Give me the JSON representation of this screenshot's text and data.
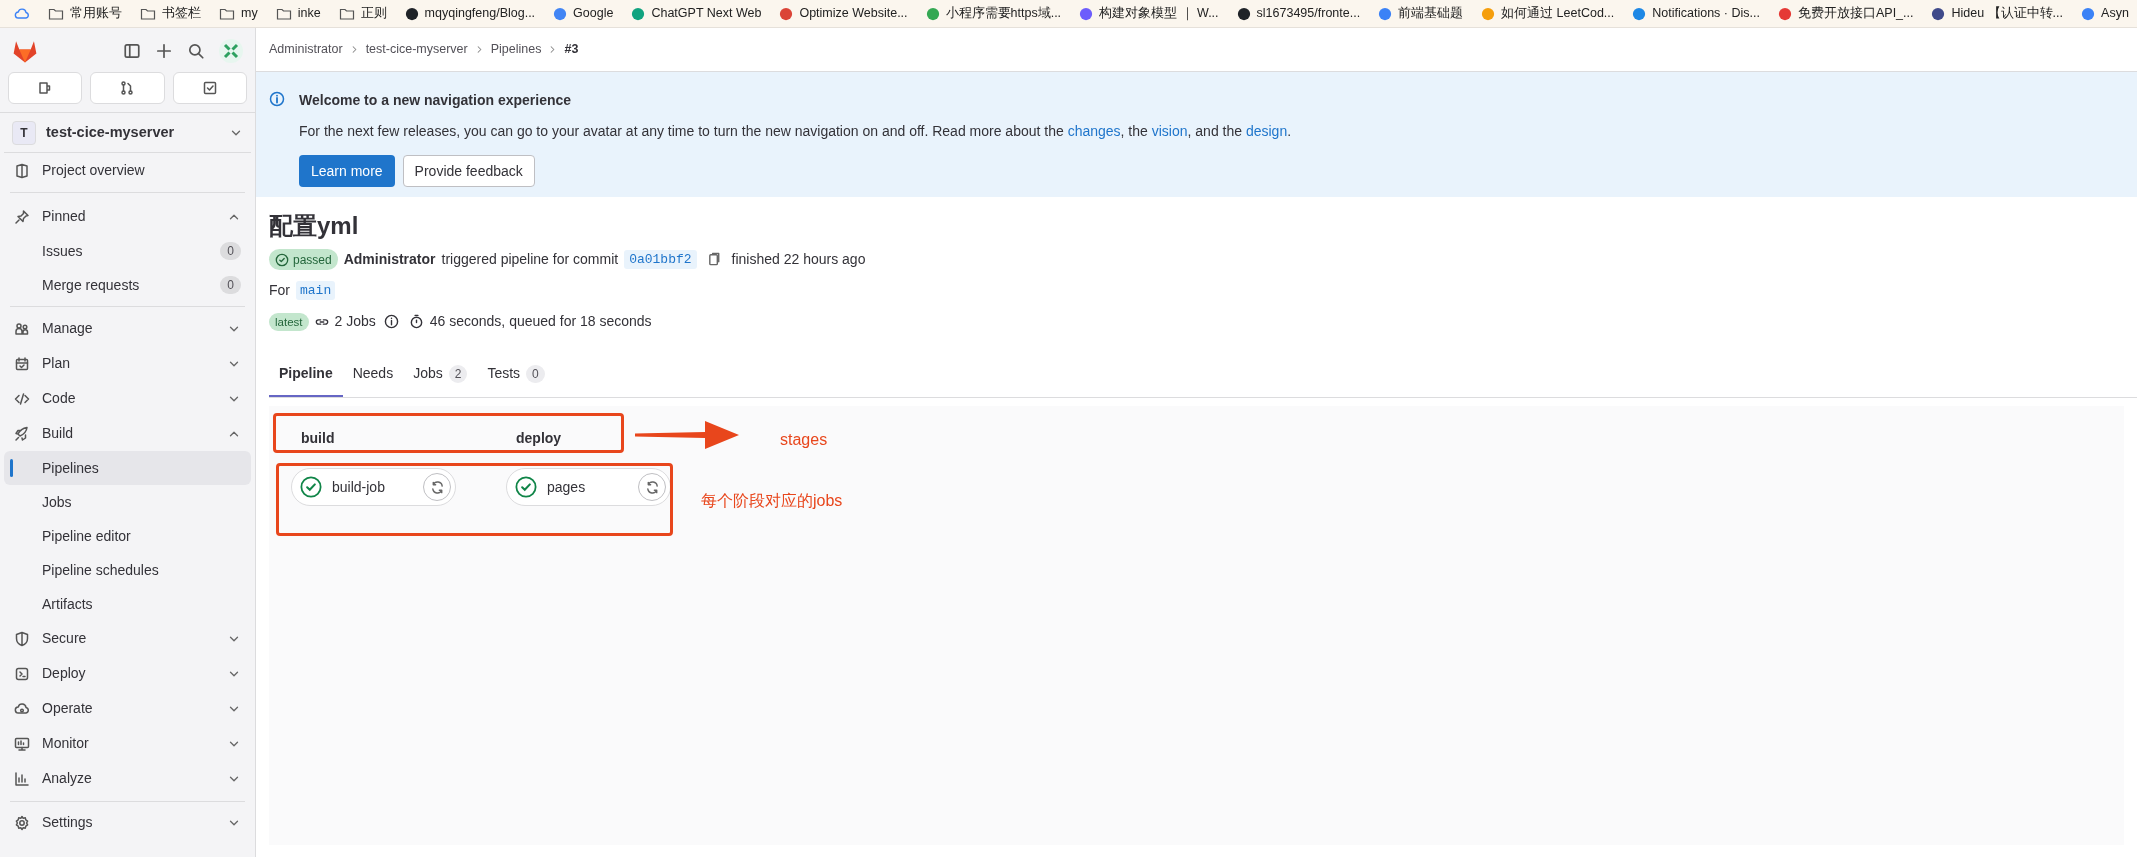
{
  "bookmarks": [
    {
      "kind": "cloud"
    },
    {
      "kind": "folder",
      "label": "常用账号"
    },
    {
      "kind": "folder",
      "label": "书签栏"
    },
    {
      "kind": "folder",
      "label": "my"
    },
    {
      "kind": "folder",
      "label": "inke"
    },
    {
      "kind": "folder",
      "label": "正则"
    },
    {
      "kind": "site",
      "label": "mqyqingfeng/Blog...",
      "color": "#1f2328"
    },
    {
      "kind": "site",
      "label": "Google",
      "color": "#4285f4"
    },
    {
      "kind": "site",
      "label": "ChatGPT Next Web",
      "color": "#10a37f"
    },
    {
      "kind": "site",
      "label": "Optimize Website...",
      "color": "#db4437"
    },
    {
      "kind": "site",
      "label": "小程序需要https域...",
      "color": "#34a853"
    },
    {
      "kind": "site",
      "label": "构建对象模型 ｜ W...",
      "color": "#6d5dfc"
    },
    {
      "kind": "site",
      "label": "sl1673495/fronte...",
      "color": "#1f2328"
    },
    {
      "kind": "site",
      "label": "前端基础题",
      "color": "#3b82f6"
    },
    {
      "kind": "site",
      "label": "如何通过 LeetCod...",
      "color": "#f59e0b"
    },
    {
      "kind": "site",
      "label": "Notifications · Dis...",
      "color": "#1e88e5"
    },
    {
      "kind": "site",
      "label": "免费开放接口API_...",
      "color": "#e53935"
    },
    {
      "kind": "site",
      "label": "Hideu 【认证中转...",
      "color": "#3f4a8a"
    },
    {
      "kind": "site",
      "label": "Asyn",
      "color": "#3b82f6"
    }
  ],
  "sidebar": {
    "project_avatar": "T",
    "project": "test-cice-myserver",
    "items": [
      {
        "kind": "link",
        "label": "Project overview"
      },
      {
        "kind": "section",
        "label": "Pinned",
        "expanded": true,
        "children": [
          {
            "label": "Issues",
            "count": "0",
            "selected": false
          },
          {
            "label": "Merge requests",
            "count": "0",
            "selected": false
          }
        ]
      },
      {
        "kind": "section",
        "label": "Manage",
        "expanded": false
      },
      {
        "kind": "section",
        "label": "Plan",
        "expanded": false
      },
      {
        "kind": "section",
        "label": "Code",
        "expanded": false
      },
      {
        "kind": "section",
        "label": "Build",
        "expanded": true,
        "children": [
          {
            "label": "Pipelines",
            "selected": true
          },
          {
            "label": "Jobs",
            "selected": false
          },
          {
            "label": "Pipeline editor",
            "selected": false
          },
          {
            "label": "Pipeline schedules",
            "selected": false
          },
          {
            "label": "Artifacts",
            "selected": false
          }
        ]
      },
      {
        "kind": "section",
        "label": "Secure",
        "expanded": false
      },
      {
        "kind": "section",
        "label": "Deploy",
        "expanded": false
      },
      {
        "kind": "section",
        "label": "Operate",
        "expanded": false
      },
      {
        "kind": "section",
        "label": "Monitor",
        "expanded": false
      },
      {
        "kind": "section",
        "label": "Analyze",
        "expanded": false
      },
      {
        "kind": "section",
        "label": "Settings",
        "expanded": false
      }
    ]
  },
  "breadcrumb": [
    "Administrator",
    "test-cice-myserver",
    "Pipelines",
    "#3"
  ],
  "banner": {
    "title": "Welcome to a new navigation experience",
    "text": "For the next few releases, you can go to your avatar at any time to turn the new navigation on and off. Read more about the ",
    "links": [
      "changes",
      "vision",
      "design"
    ],
    "joiners": [
      ", the ",
      ", and the ",
      "."
    ],
    "primary_button": "Learn more",
    "secondary_button": "Provide feedback"
  },
  "pipeline": {
    "title": "配置yml",
    "status": "passed",
    "author": "Administrator",
    "trigger_text": "triggered pipeline for commit",
    "commit": "0a01bbf2",
    "finished": "finished 22 hours ago",
    "for_label": "For",
    "ref": "main",
    "badge": "latest",
    "jobs_count": "2 Jobs",
    "duration": "46 seconds, queued for 18 seconds"
  },
  "tabs": [
    {
      "label": "Pipeline",
      "selected": true
    },
    {
      "label": "Needs",
      "selected": false
    },
    {
      "label": "Jobs",
      "count": "2",
      "selected": false
    },
    {
      "label": "Tests",
      "count": "0",
      "selected": false
    }
  ],
  "stages": [
    {
      "name": "build",
      "jobs": [
        {
          "name": "build-job",
          "passed": true
        }
      ]
    },
    {
      "name": "deploy",
      "jobs": [
        {
          "name": "pages",
          "passed": true
        }
      ]
    }
  ],
  "annotations": [
    "stages",
    "每个阶段对应的jobs"
  ]
}
